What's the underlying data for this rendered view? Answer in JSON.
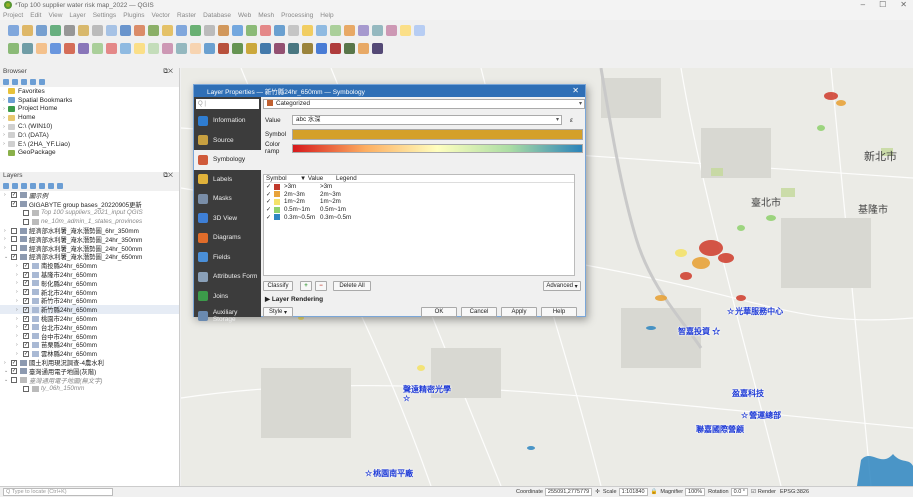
{
  "window": {
    "title": "*Top 100 supplier water risk map_2022 — QGIS",
    "controls": [
      "–",
      "☐",
      "✕"
    ]
  },
  "menu": [
    "Project",
    "Edit",
    "View",
    "Layer",
    "Settings",
    "Plugins",
    "Vector",
    "Raster",
    "Database",
    "Web",
    "Mesh",
    "Processing",
    "Help"
  ],
  "browser": {
    "title": "Browser",
    "items": [
      {
        "label": "Favorites",
        "arrow": "",
        "icon": "star-icon"
      },
      {
        "label": "Spatial Bookmarks",
        "arrow": "›",
        "icon": "bookmark-icon"
      },
      {
        "label": "Project Home",
        "arrow": "›",
        "icon": "project-home-icon"
      },
      {
        "label": "Home",
        "arrow": "›",
        "icon": "home-folder-icon"
      },
      {
        "label": "C:\\ (WIN10)",
        "arrow": "›",
        "icon": "drive-icon"
      },
      {
        "label": "D:\\ (DATA)",
        "arrow": "›",
        "icon": "drive-icon"
      },
      {
        "label": "E:\\ (2HA_YF.Liao)",
        "arrow": "›",
        "icon": "drive-icon"
      },
      {
        "label": "GeoPackage",
        "arrow": "",
        "icon": "geopackage-icon"
      }
    ]
  },
  "layers": {
    "title": "Layers",
    "rows": [
      {
        "label": "圖示例",
        "indent": 1,
        "checked": true,
        "italic": true,
        "grey": false,
        "sel": false,
        "arrow": "›"
      },
      {
        "label": "GIGABYTE group bases_20220905更新",
        "indent": 1,
        "checked": true,
        "italic": false,
        "grey": false,
        "sel": false,
        "arrow": ""
      },
      {
        "label": "Top 100 suppliers_2021_input QGIS",
        "indent": 2,
        "checked": false,
        "italic": true,
        "grey": true,
        "sel": false,
        "arrow": ""
      },
      {
        "label": "ne_10m_admin_1_states_provinces",
        "indent": 2,
        "checked": false,
        "italic": true,
        "grey": true,
        "sel": false,
        "arrow": ""
      },
      {
        "label": "經濟部水利署_淹水潛勢圖_6hr_350mm",
        "indent": 1,
        "checked": false,
        "italic": false,
        "grey": false,
        "sel": false,
        "arrow": "›"
      },
      {
        "label": "經濟部水利署_淹水潛勢圖_24hr_350mm",
        "indent": 1,
        "checked": false,
        "italic": false,
        "grey": false,
        "sel": false,
        "arrow": "›"
      },
      {
        "label": "經濟部水利署_淹水潛勢圖_24hr_500mm",
        "indent": 1,
        "checked": false,
        "italic": false,
        "grey": false,
        "sel": false,
        "arrow": "›"
      },
      {
        "label": "經濟部水利署_淹水潛勢圖_24hr_650mm",
        "indent": 1,
        "checked": true,
        "italic": false,
        "grey": false,
        "sel": false,
        "arrow": "⌄"
      },
      {
        "label": "南投縣24hr_650mm",
        "indent": 2,
        "checked": true,
        "italic": false,
        "grey": false,
        "sel": false,
        "arrow": "›"
      },
      {
        "label": "基隆市24hr_650mm",
        "indent": 2,
        "checked": true,
        "italic": false,
        "grey": false,
        "sel": false,
        "arrow": "›"
      },
      {
        "label": "彰化縣24hr_650mm",
        "indent": 2,
        "checked": true,
        "italic": false,
        "grey": false,
        "sel": false,
        "arrow": "›"
      },
      {
        "label": "新北市24hr_650mm",
        "indent": 2,
        "checked": true,
        "italic": false,
        "grey": false,
        "sel": false,
        "arrow": "›"
      },
      {
        "label": "新竹市24hr_650mm",
        "indent": 2,
        "checked": true,
        "italic": false,
        "grey": false,
        "sel": false,
        "arrow": "›"
      },
      {
        "label": "新竹縣24hr_650mm",
        "indent": 2,
        "checked": true,
        "italic": false,
        "grey": false,
        "sel": true,
        "arrow": "›"
      },
      {
        "label": "桃園市24hr_650mm",
        "indent": 2,
        "checked": true,
        "italic": false,
        "grey": false,
        "sel": false,
        "arrow": "›"
      },
      {
        "label": "台北市24hr_650mm",
        "indent": 2,
        "checked": true,
        "italic": false,
        "grey": false,
        "sel": false,
        "arrow": "›"
      },
      {
        "label": "台中市24hr_650mm",
        "indent": 2,
        "checked": true,
        "italic": false,
        "grey": false,
        "sel": false,
        "arrow": "›"
      },
      {
        "label": "苗栗縣24hr_650mm",
        "indent": 2,
        "checked": true,
        "italic": false,
        "grey": false,
        "sel": false,
        "arrow": "›"
      },
      {
        "label": "雲林縣24hr_650mm",
        "indent": 2,
        "checked": true,
        "italic": false,
        "grey": false,
        "sel": false,
        "arrow": "›"
      },
      {
        "label": "國土利用現況調查-4農水利",
        "indent": 1,
        "checked": true,
        "italic": false,
        "grey": false,
        "sel": false,
        "arrow": "›"
      },
      {
        "label": "臺灣通用電子地圖(灰階)",
        "indent": 1,
        "checked": true,
        "italic": false,
        "grey": false,
        "sel": false,
        "arrow": "⌄"
      },
      {
        "label": "臺灣通用電子地圖(無文字)",
        "indent": 1,
        "checked": false,
        "italic": true,
        "grey": true,
        "sel": false,
        "arrow": "⌄"
      },
      {
        "label": "ty_06h_150mm",
        "indent": 2,
        "checked": false,
        "italic": true,
        "grey": true,
        "sel": false,
        "arrow": ""
      }
    ]
  },
  "dialog": {
    "title": "Layer Properties — 新竹縣24hr_650mm — Symbology",
    "search_placeholder": "Q |",
    "sidebar": [
      {
        "label": "Information",
        "icon": "information-icon",
        "color": "#2f7dd1"
      },
      {
        "label": "Source",
        "icon": "source-icon",
        "color": "#c8a040"
      },
      {
        "label": "Symbology",
        "icon": "symbology-icon",
        "color": "#d05a3a"
      },
      {
        "label": "Labels",
        "icon": "labels-icon",
        "color": "#e0b23a"
      },
      {
        "label": "Masks",
        "icon": "masks-icon",
        "color": "#7a8ea8"
      },
      {
        "label": "3D View",
        "icon": "3d-view-icon",
        "color": "#3e7fd6"
      },
      {
        "label": "Diagrams",
        "icon": "diagrams-icon",
        "color": "#e06c2a"
      },
      {
        "label": "Fields",
        "icon": "fields-icon",
        "color": "#4a8fd8"
      },
      {
        "label": "Attributes Form",
        "icon": "attributes-form-icon",
        "color": "#8aa0b8"
      },
      {
        "label": "Joins",
        "icon": "joins-icon",
        "color": "#3c9b4a"
      },
      {
        "label": "Auxiliary Storage",
        "icon": "auxiliary-storage-icon",
        "color": "#6a8ab0"
      }
    ],
    "renderer": "Categorized",
    "value_label": "Value",
    "value": "abc 水深",
    "symbol_label": "Symbol",
    "ramp_label": "Color ramp",
    "columns": [
      "Symbol",
      "▼ Value",
      "Legend"
    ],
    "classes": [
      {
        "value": ">3m",
        "legend": ">3m",
        "color": "#c0392b"
      },
      {
        "value": "2m~3m",
        "legend": "2m~3m",
        "color": "#e8a33a"
      },
      {
        "value": "1m~2m",
        "legend": "1m~2m",
        "color": "#f4e26a"
      },
      {
        "value": "0.5m~1m",
        "legend": "0.5m~1m",
        "color": "#8fd16d"
      },
      {
        "value": "0.3m~0.5m",
        "legend": "0.3m~0.5m",
        "color": "#2e86c1"
      }
    ],
    "classify_label": "Classify",
    "delete_all_label": "Delete All",
    "advanced_label": "Advanced",
    "layer_rendering_label": "Layer Rendering",
    "style_label": "Style",
    "ok_label": "OK",
    "cancel_label": "Cancel",
    "apply_label": "Apply",
    "help_label": "Help"
  },
  "map": {
    "city_labels": [
      {
        "text": "新北市"
      },
      {
        "text": "臺北市"
      },
      {
        "text": "基隆市"
      }
    ],
    "pois": [
      {
        "text": "光華服務中心"
      },
      {
        "text": "智嘉投資"
      },
      {
        "text": "聲遠精密光學"
      },
      {
        "text": "盈嘉科技"
      },
      {
        "text": "營運總部"
      },
      {
        "text": "聯嘉國際營顧"
      },
      {
        "text": "桃園南平廠"
      }
    ]
  },
  "statusbar": {
    "locate_placeholder": "Q Type to locate (Ctrl+K)",
    "coordinate_label": "Coordinate",
    "coordinate": "255091,2775779",
    "scale_label": "Scale",
    "scale": "1:101840",
    "magnifier_label": "Magnifier",
    "magnifier": "100%",
    "rotation_label": "Rotation",
    "rotation": "0.0 °",
    "render_label": "Render",
    "crs": "EPSG:3826"
  }
}
